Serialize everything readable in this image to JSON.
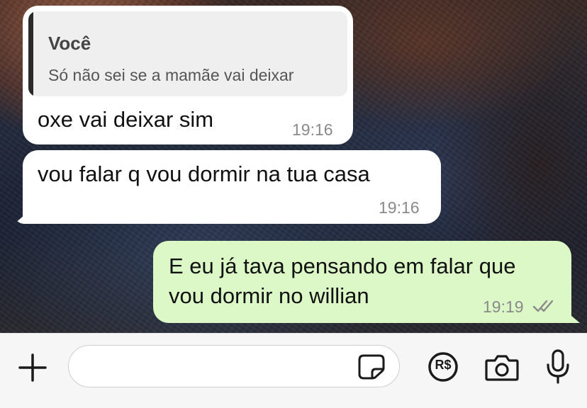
{
  "messages": [
    {
      "direction": "incoming",
      "quote": {
        "author": "Você",
        "text": "Só não sei se a mamãe vai deixar"
      },
      "text": "oxe vai deixar sim",
      "time": "19:16"
    },
    {
      "direction": "incoming",
      "text": "vou falar q vou dormir na tua casa",
      "time": "19:16"
    },
    {
      "direction": "outgoing",
      "lines": [
        "E eu já tava pensando em falar que",
        "vou dormir no willian"
      ],
      "time": "19:19",
      "status": "read"
    }
  ],
  "input_bar": {
    "message_value": "",
    "icons": [
      "plus-icon",
      "sticker-icon",
      "payment-icon",
      "camera-icon",
      "microphone-icon"
    ],
    "payment_label": "R$"
  },
  "colors": {
    "incoming_bubble": "#ffffff",
    "outgoing_bubble": "#dcf8c6",
    "quote_background": "#efefef",
    "read_check": "#8a8a8a"
  }
}
